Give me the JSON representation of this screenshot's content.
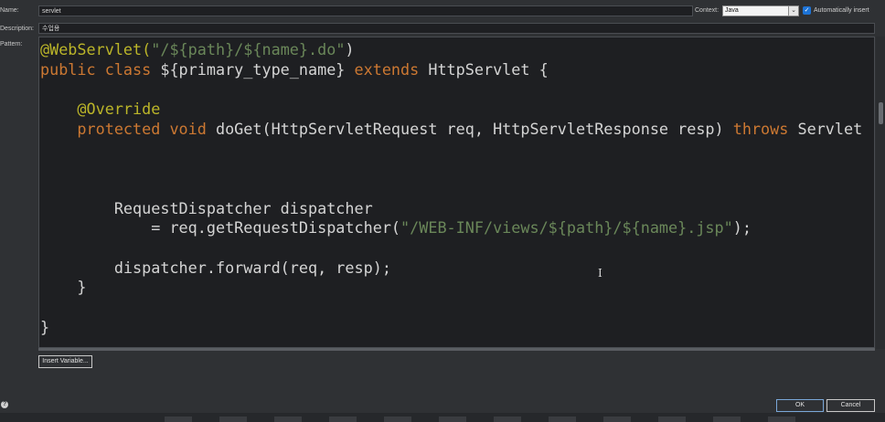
{
  "form": {
    "name_label": "Name:",
    "name_value": "servlet",
    "description_label": "Description:",
    "description_value": "수업용",
    "pattern_label": "Pattern:",
    "context_label": "Context:",
    "context_value": "Java",
    "auto_insert_label": "Automatically insert",
    "auto_insert_checked": true
  },
  "pattern": {
    "lines": [
      [
        {
          "t": "@WebServlet(",
          "c": "ann"
        },
        {
          "t": "\"/${path}/${name}.do\"",
          "c": "str"
        },
        {
          "t": ")",
          "c": ""
        }
      ],
      [
        {
          "t": "public class ",
          "c": "kw"
        },
        {
          "t": "${primary_type_name} ",
          "c": ""
        },
        {
          "t": "extends ",
          "c": "kw"
        },
        {
          "t": "HttpServlet {",
          "c": ""
        }
      ],
      [],
      [
        {
          "t": "    @Override",
          "c": "ann"
        }
      ],
      [
        {
          "t": "    protected void ",
          "c": "kw"
        },
        {
          "t": "doGet(HttpServletRequest req, HttpServletResponse resp) ",
          "c": ""
        },
        {
          "t": "throws ",
          "c": "kw"
        },
        {
          "t": "Servlet",
          "c": ""
        }
      ],
      [],
      [],
      [],
      [
        {
          "t": "        RequestDispatcher dispatcher",
          "c": ""
        }
      ],
      [
        {
          "t": "            = req.getRequestDispatcher(",
          "c": ""
        },
        {
          "t": "\"/WEB-INF/views/${path}/${name}.jsp\"",
          "c": "str"
        },
        {
          "t": ");",
          "c": ""
        }
      ],
      [],
      [
        {
          "t": "        dispatcher.forward(req, resp);",
          "c": ""
        }
      ],
      [
        {
          "t": "    }",
          "c": ""
        }
      ],
      [],
      [
        {
          "t": "}",
          "c": ""
        }
      ]
    ]
  },
  "buttons": {
    "insert_variable": "Insert Variable...",
    "ok": "OK",
    "cancel": "Cancel"
  },
  "icons": {
    "help": "help-icon",
    "checkbox": "checkmark-icon",
    "dropdown": "chevron-down-icon",
    "text_cursor": "text-cursor-icon"
  },
  "glyphs": {
    "check": "✓",
    "chevron": "⌄",
    "help": "?",
    "ibeam": "I"
  },
  "colors": {
    "annotation": "#bbb529",
    "keyword": "#cc7832",
    "string": "#6a8759",
    "text": "#d4d4d4",
    "editor_bg": "#1e1f22",
    "dialog_bg": "#2f3134",
    "accent": "#1d73d6"
  }
}
